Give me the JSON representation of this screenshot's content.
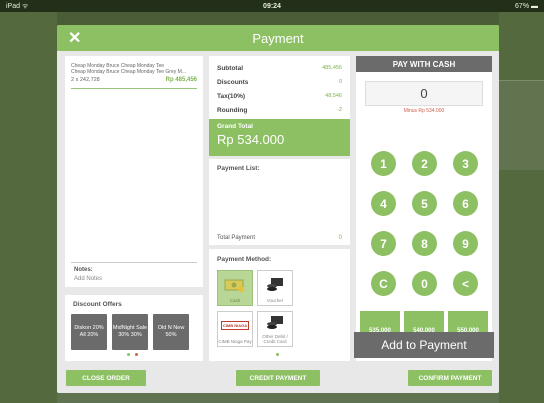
{
  "status_bar": {
    "left": "iPad ᯤ",
    "time": "09:24",
    "right": "67% ▬"
  },
  "modal": {
    "title": "Payment"
  },
  "order": {
    "item_name": "Cheap Monday Bruce Cheap Monday Tee",
    "item_desc": "Cheap Monday Bruce Cheap Monday Tee Grey M...",
    "qty_line": "2 x 242,728",
    "item_total": "Rp 485,456",
    "notes_label": "Notes:",
    "notes_placeholder": "Add Notes"
  },
  "discount": {
    "title": "Discount Offers",
    "offers": [
      "Diskon 20% All 20%",
      "MidNight Sale 30% 30%",
      "Old N New 50%"
    ]
  },
  "summary": {
    "rows": [
      {
        "label": "Subtotal",
        "value": "485,456"
      },
      {
        "label": "Discounts",
        "value": "0"
      },
      {
        "label": "Tax(10%)",
        "value": "48,546"
      },
      {
        "label": "Rounding",
        "value": "-2"
      }
    ],
    "grand_label": "Grand Total",
    "grand_value": "Rp 534.000"
  },
  "payment_list": {
    "title": "Payment List:",
    "total_label": "Total Payment",
    "total_value": "0"
  },
  "payment_method": {
    "title": "Payment Method:",
    "methods": [
      "Cash",
      "Voucher",
      "CIMB Niaga Pay",
      "Other Debit / Credit Card"
    ],
    "cimb_logo": "CIMB NIAGA"
  },
  "cash": {
    "title": "PAY WITH CASH",
    "display": "0",
    "minus_text": "Minus Rp 534.000",
    "keys": [
      "1",
      "2",
      "3",
      "4",
      "5",
      "6",
      "7",
      "8",
      "9",
      "C",
      "0",
      "<"
    ],
    "amounts": [
      "535,000",
      "540,000",
      "550,000"
    ],
    "add_label": "Add to Payment"
  },
  "footer": {
    "close": "CLOSE ORDER",
    "credit": "CREDIT PAYMENT",
    "confirm": "CONFIRM PAYMENT"
  },
  "colors": {
    "accent": "#8cc063",
    "dark": "#6b6b6b",
    "minus": "#d0604f"
  }
}
